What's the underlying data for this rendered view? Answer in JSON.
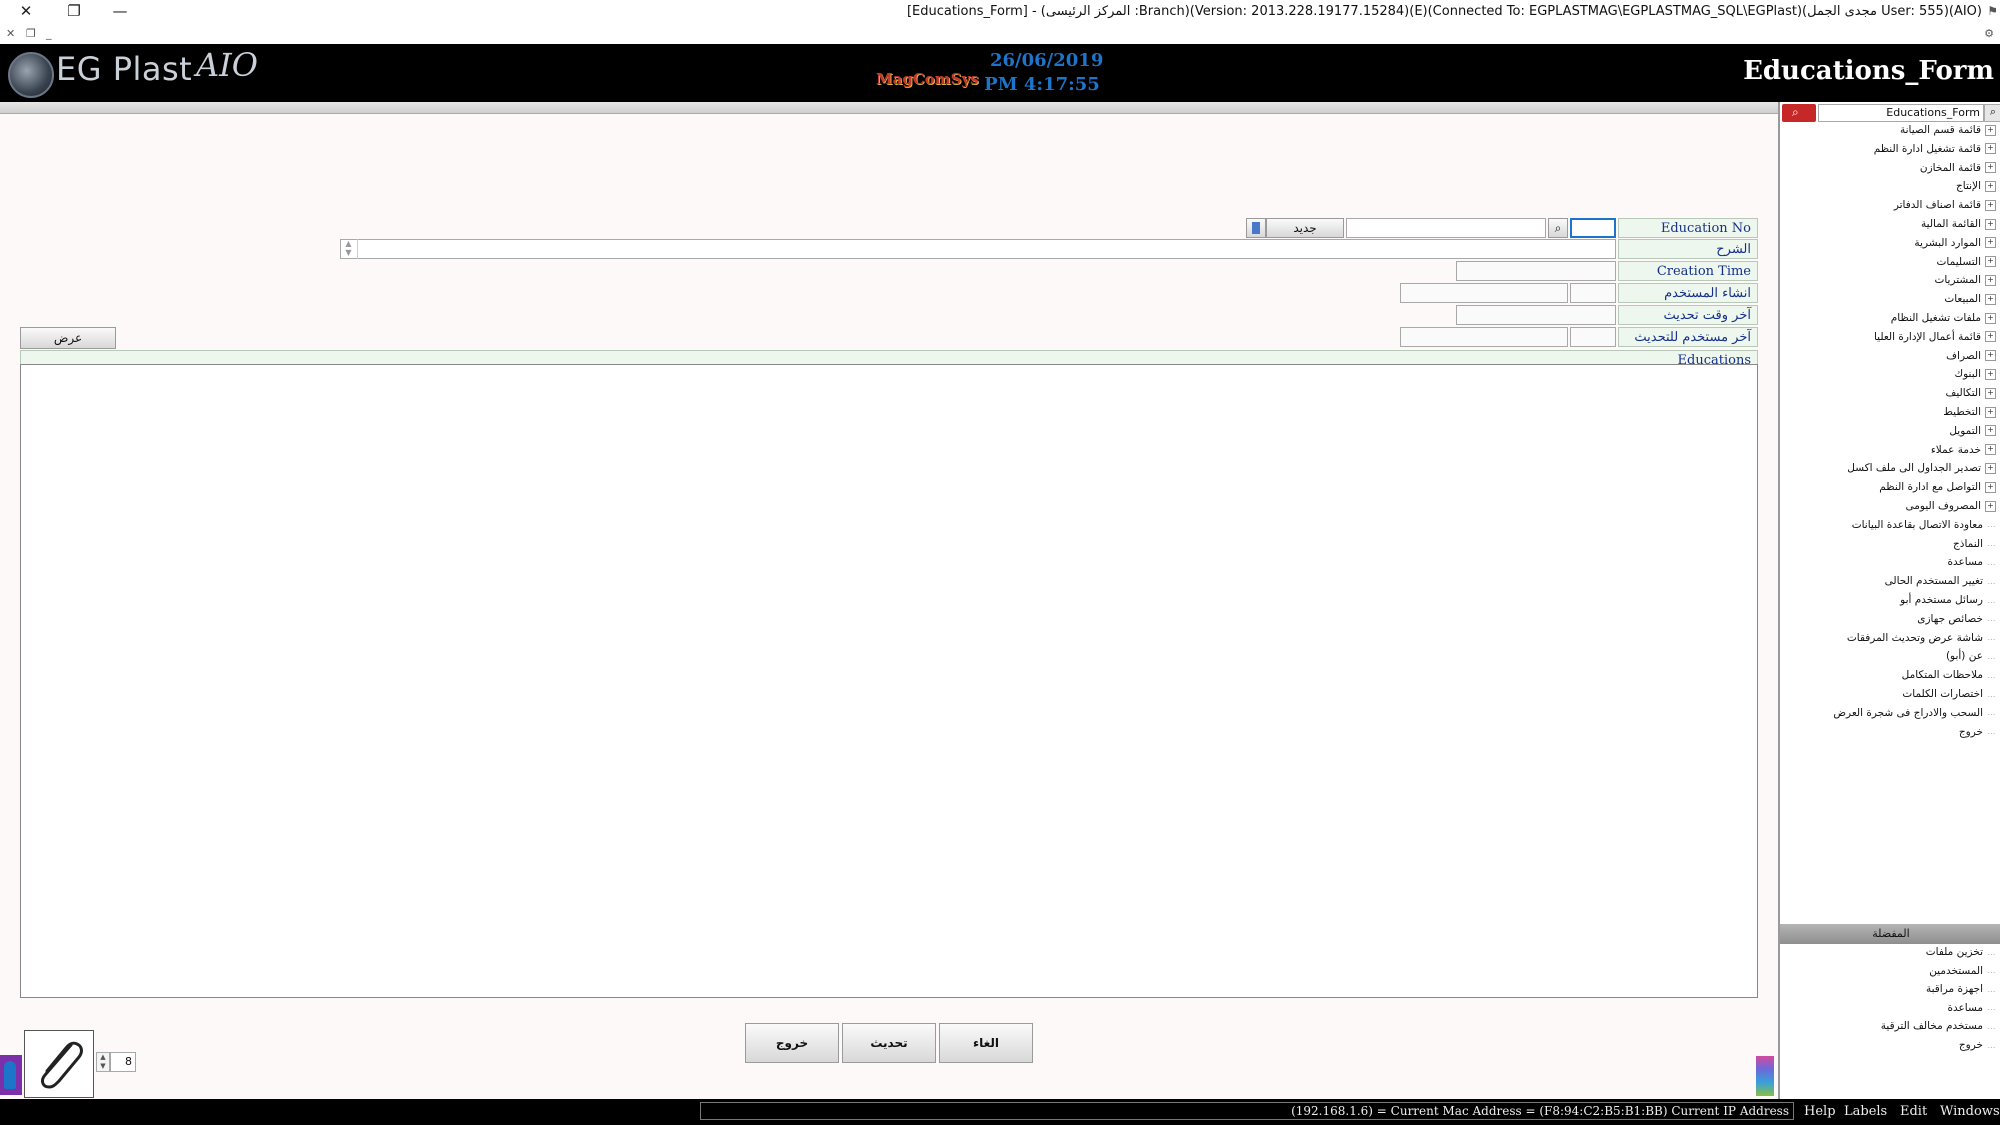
{
  "window": {
    "title": "[Educations_Form] - (المركز الرئيسى :Branch)(Version: 2013.228.19177.15284)(E)(Connected To: EGPLASTMAG\\EGPLASTMAG_SQL\\EGPlast)(مجدى الجمل User: 555)(AIO)",
    "close_glyph": "✕",
    "restore_glyph": "❐",
    "minimize_glyph": "—",
    "mdi_close_glyph": "✕",
    "mdi_restore_glyph": "❐",
    "mdi_min_glyph": "_"
  },
  "header": {
    "logo_text": "EG Plast",
    "logo_suffix": "AIO",
    "brand": "MagComSys",
    "date": "26/06/2019",
    "time": "PM 4:17:55",
    "form_title": "Educations_Form"
  },
  "form": {
    "education_no_label": "Education No",
    "education_no_value": "",
    "search_value": "",
    "new_button": "جديد",
    "description_label": "الشرح",
    "creation_time_label": "Creation Time",
    "created_by_label": "انشاء المستخدم",
    "last_update_time_label": "آخر وقت تحديث",
    "last_update_user_label": "آخر مستخدم للتحديث",
    "display_button": "عرض",
    "grid_title": "Educations"
  },
  "bottom": {
    "exit_button": "خروج",
    "refresh_button": "تحديث",
    "cancel_button": "الغاء",
    "attachment_count": "8"
  },
  "sidebar": {
    "search_value": "Educations_Form",
    "tree": [
      {
        "label": "قائمة قسم الصيانة",
        "expandable": true
      },
      {
        "label": "قائمة تشغيل ادارة النظم",
        "expandable": true
      },
      {
        "label": "قائمة المخازن",
        "expandable": true
      },
      {
        "label": "الإنتاج",
        "expandable": true
      },
      {
        "label": "قائمة اصناف الدفاتر",
        "expandable": true
      },
      {
        "label": "القائمة المالية",
        "expandable": true
      },
      {
        "label": "الموارد البشرية",
        "expandable": true
      },
      {
        "label": "التسليمات",
        "expandable": true
      },
      {
        "label": "المشتريات",
        "expandable": true
      },
      {
        "label": "المبيعات",
        "expandable": true
      },
      {
        "label": "ملفات تشغيل النظام",
        "expandable": true
      },
      {
        "label": "قائمة أعمال الإدارة العليا",
        "expandable": true
      },
      {
        "label": "الصراف",
        "expandable": true
      },
      {
        "label": "البنوك",
        "expandable": true
      },
      {
        "label": "التكاليف",
        "expandable": true
      },
      {
        "label": "التخطيط",
        "expandable": true
      },
      {
        "label": "التمويل",
        "expandable": true
      },
      {
        "label": "خدمة عملاء",
        "expandable": true
      },
      {
        "label": "تصدير الجداول الى ملف اكسل",
        "expandable": true
      },
      {
        "label": "التواصل مع ادارة النظم",
        "expandable": true
      },
      {
        "label": "المصروف اليومى",
        "expandable": true
      },
      {
        "label": "معاودة الاتصال بقاعدة البيانات",
        "expandable": false
      },
      {
        "label": "النماذج",
        "expandable": false
      },
      {
        "label": "مساعدة",
        "expandable": false
      },
      {
        "label": "تغيير المستخدم الحالى",
        "expandable": false
      },
      {
        "label": "رسائل مستخدم أبو",
        "expandable": false
      },
      {
        "label": "خصائص جهازى",
        "expandable": false
      },
      {
        "label": "شاشة عرض وتحديث المرفقات",
        "expandable": false
      },
      {
        "label": "عن (أبو)",
        "expandable": false
      },
      {
        "label": "ملاحظات المتكامل",
        "expandable": false
      },
      {
        "label": "اختصارات الكلمات",
        "expandable": false
      },
      {
        "label": "السحب والادراج فى شجرة العرض",
        "expandable": false
      },
      {
        "label": "خروج",
        "expandable": false
      }
    ],
    "favorites_title": "المفضلة",
    "favorites": [
      {
        "label": "تخزين ملفات"
      },
      {
        "label": "المستخدمين"
      },
      {
        "label": "اجهزة مراقبة"
      },
      {
        "label": "مساعدة"
      },
      {
        "label": "مستخدم مخالف الترقية"
      },
      {
        "label": "خروج"
      }
    ]
  },
  "statusbar": {
    "ip_info": "(192.168.1.6) = Current Mac Address = (F8:94:C2:B5:B1:BB) Current IP Address",
    "menu": [
      "Help",
      "Labels",
      "Edit",
      "Windows"
    ]
  },
  "colors": {
    "header_bg": "#000000",
    "accent_blue": "#1e74c9",
    "label_bg": "#eef7ee",
    "label_text": "#16308a",
    "search_red": "#c62828"
  }
}
